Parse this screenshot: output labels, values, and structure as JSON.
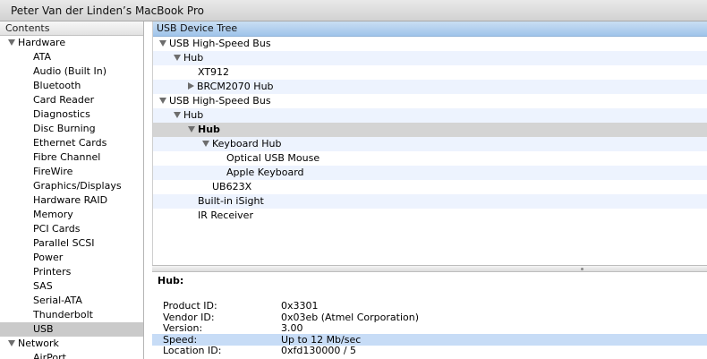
{
  "window": {
    "title": "Peter Van der Linden’s MacBook Pro"
  },
  "sidebar": {
    "header": "Contents",
    "hardware": {
      "label": "Hardware",
      "items": [
        "ATA",
        "Audio (Built In)",
        "Bluetooth",
        "Card Reader",
        "Diagnostics",
        "Disc Burning",
        "Ethernet Cards",
        "Fibre Channel",
        "FireWire",
        "Graphics/Displays",
        "Hardware RAID",
        "Memory",
        "PCI Cards",
        "Parallel SCSI",
        "Power",
        "Printers",
        "SAS",
        "Serial-ATA",
        "Thunderbolt",
        "USB"
      ],
      "selected": "USB"
    },
    "network": {
      "label": "Network",
      "items": [
        "AirPort"
      ]
    }
  },
  "tree": {
    "header": "USB Device Tree",
    "rows": [
      {
        "label": "USB High-Speed Bus",
        "level": 0,
        "disclosure": "open"
      },
      {
        "label": "Hub",
        "level": 1,
        "disclosure": "open"
      },
      {
        "label": "XT912",
        "level": 2,
        "disclosure": "none"
      },
      {
        "label": "BRCM2070 Hub",
        "level": 2,
        "disclosure": "closed"
      },
      {
        "label": "USB High-Speed Bus",
        "level": 0,
        "disclosure": "open"
      },
      {
        "label": "Hub",
        "level": 1,
        "disclosure": "open"
      },
      {
        "label": "Hub",
        "level": 2,
        "disclosure": "open",
        "selected": true
      },
      {
        "label": "Keyboard Hub",
        "level": 3,
        "disclosure": "open"
      },
      {
        "label": "Optical USB Mouse",
        "level": 4,
        "disclosure": "none"
      },
      {
        "label": "Apple Keyboard",
        "level": 4,
        "disclosure": "none"
      },
      {
        "label": "UB623X",
        "level": 3,
        "disclosure": "none"
      },
      {
        "label": "Built-in iSight",
        "level": 2,
        "disclosure": "none"
      },
      {
        "label": "IR Receiver",
        "level": 2,
        "disclosure": "none"
      }
    ]
  },
  "details": {
    "title": "Hub:",
    "properties": [
      {
        "key": "Product ID:",
        "value": "0x3301"
      },
      {
        "key": "Vendor ID:",
        "value": "0x03eb  (Atmel Corporation)"
      },
      {
        "key": "Version:",
        "value": " 3.00"
      },
      {
        "key": "Speed:",
        "value": "Up to 12 Mb/sec",
        "highlight": true
      },
      {
        "key": "Location ID:",
        "value": "0xfd130000 / 5"
      }
    ]
  },
  "colors": {
    "tree_header": "#9fc4ea",
    "row_stripe": "#edf3fe",
    "selection": "#cacaca",
    "detail_highlight": "#c7dcf6"
  }
}
